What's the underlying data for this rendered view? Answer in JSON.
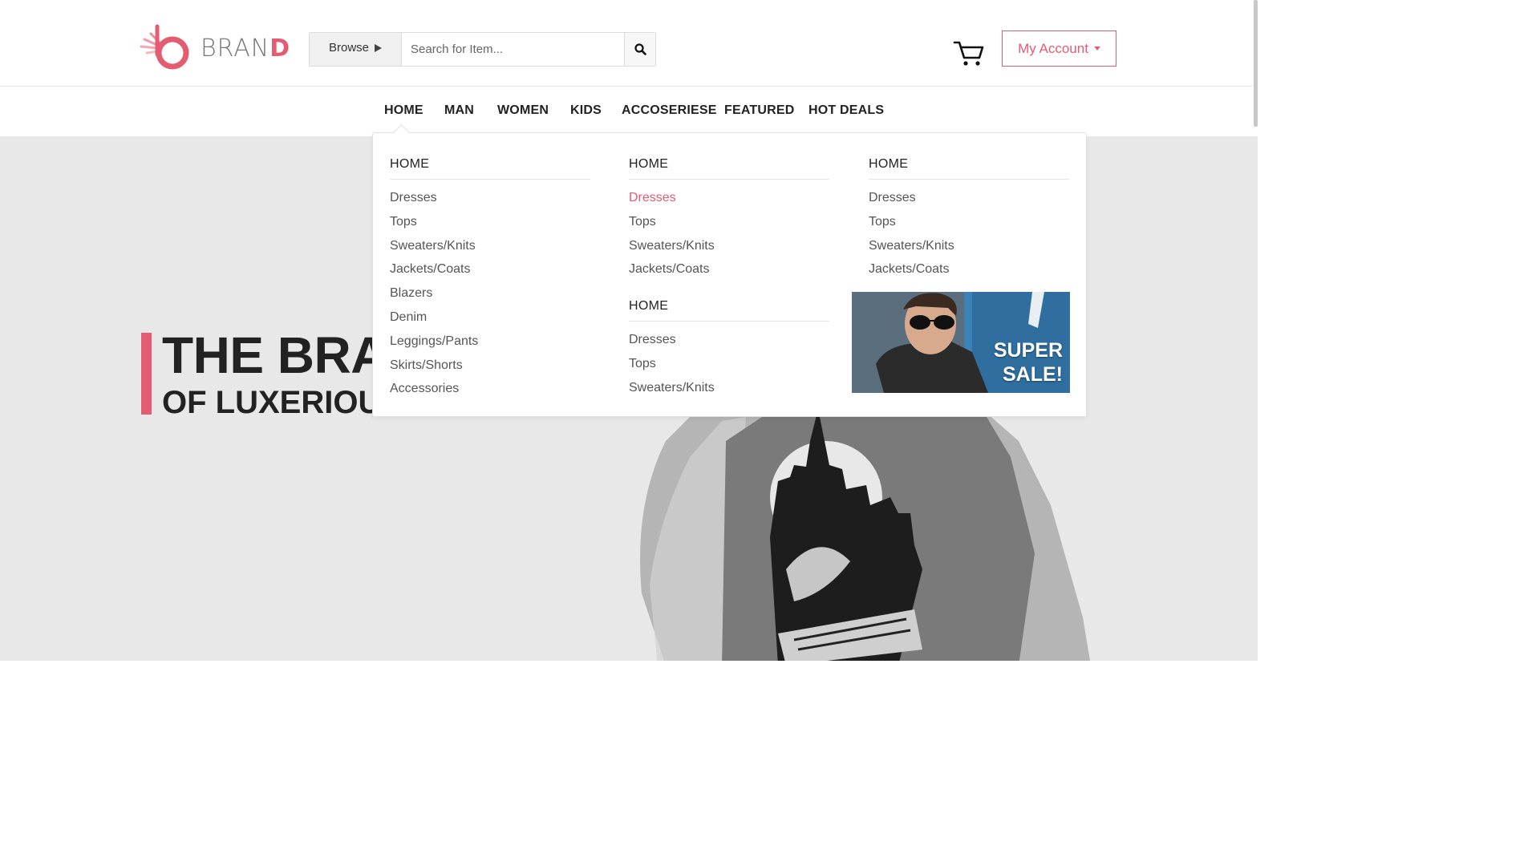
{
  "brand": {
    "name_main": "BRAN",
    "name_accent": "D",
    "accent_color": "#e45c72"
  },
  "search": {
    "browse_label": "Browse",
    "placeholder": "Search for Item..."
  },
  "account": {
    "label": "My Account"
  },
  "nav": {
    "items": [
      "HOME",
      "MAN",
      "WOMEN",
      "KIDS",
      "ACCOSERIESE",
      "FEATURED",
      "HOT DEALS"
    ]
  },
  "hero": {
    "title": "THE BRA",
    "subtitle": "OF LUXERIOU"
  },
  "mega_menu": {
    "col1": {
      "heading": "HOME",
      "items": [
        "Dresses",
        "Tops",
        "Sweaters/Knits",
        "Jackets/Coats",
        "Blazers",
        "Denim",
        "Leggings/Pants",
        "Skirts/Shorts",
        "Accessories"
      ]
    },
    "col2": {
      "heading": "HOME",
      "items": [
        "Dresses",
        "Tops",
        "Sweaters/Knits",
        "Jackets/Coats"
      ],
      "active_index": 0
    },
    "col2b": {
      "heading": "HOME",
      "items": [
        "Dresses",
        "Tops",
        "Sweaters/Knits"
      ]
    },
    "col3": {
      "heading": "HOME",
      "items": [
        "Dresses",
        "Tops",
        "Sweaters/Knits",
        "Jackets/Coats"
      ]
    },
    "promo": {
      "line1": "SUPER",
      "line2": "SALE!"
    }
  },
  "icons": {
    "search": "search-icon",
    "cart": "cart-icon",
    "browse_arrow": "triangle-right-icon",
    "account_caret": "caret-down-icon"
  }
}
